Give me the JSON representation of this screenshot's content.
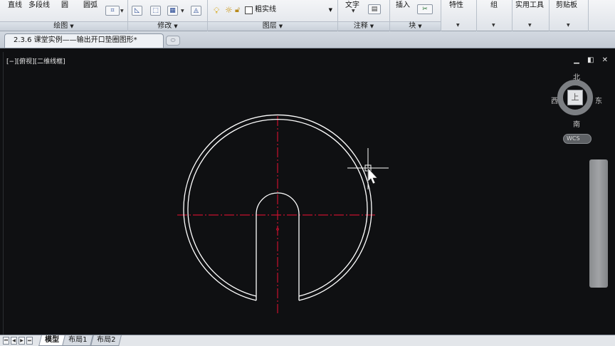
{
  "ribbon": {
    "tools": {
      "line": "直线",
      "polyline": "多段线",
      "circle": "圆",
      "arc": "圆弧",
      "text": "文字",
      "insert": "插入"
    },
    "panels": {
      "draw": "绘图",
      "modify": "修改",
      "layers": "图层",
      "annotation": "注释",
      "block": "块",
      "properties": "特性",
      "groups": "组",
      "utilities": "实用工具",
      "clipboard": "剪贴板"
    },
    "layer_combo": "粗实线"
  },
  "document_tab": "2.3.6 课堂实例——输出开口垫圈图形*",
  "viewport": {
    "label": "[−][俯视][二维线框]",
    "window_controls": "▁ ◧ ✕"
  },
  "viewcube": {
    "north": "北",
    "south": "南",
    "east": "东",
    "west": "西",
    "face": "上",
    "wcs": "WCS"
  },
  "layout_tabs": [
    "模型",
    "布局1",
    "布局2"
  ],
  "colors": {
    "canvas": "#0f1012",
    "geometry": "#ffffff",
    "centerline": "#c8102e"
  },
  "icons": [
    "light-bulb-icon",
    "sun-icon",
    "lock-icon",
    "layer-color-icon",
    "table-icon",
    "scissors-icon"
  ]
}
